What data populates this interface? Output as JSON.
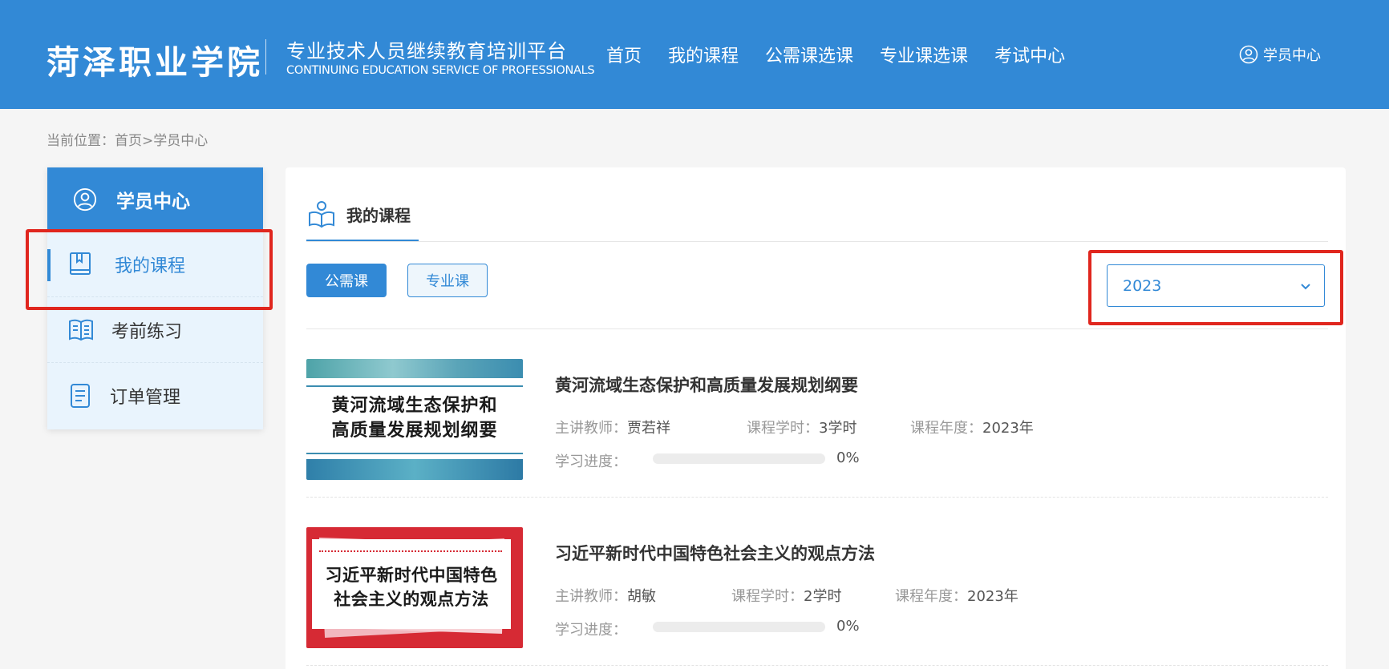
{
  "header": {
    "logo": "菏泽职业学院",
    "platform_cn": "专业技术人员继续教育培训平台",
    "platform_en": "CONTINUING EDUCATION SERVICE OF PROFESSIONALS",
    "nav": [
      "首页",
      "我的课程",
      "公需课选课",
      "专业课选课",
      "考试中心"
    ],
    "user_link": "学员中心",
    "bg_color": "#3289d6"
  },
  "breadcrumb": "当前位置：首页>学员中心",
  "sidebar": {
    "title": "学员中心",
    "items": [
      {
        "label": "我的课程",
        "icon": "book-icon",
        "active": true
      },
      {
        "label": "考前练习",
        "icon": "open-book-icon",
        "active": false
      },
      {
        "label": "订单管理",
        "icon": "document-icon",
        "active": false
      }
    ]
  },
  "main": {
    "tab_label": "我的课程",
    "tab_icon": "reading-person-icon",
    "filters": {
      "public": "公需课",
      "professional": "专业课"
    },
    "year_select": {
      "value": "2023"
    },
    "courses": [
      {
        "thumb_text_1": "黄河流域生态保护和",
        "thumb_text_2": "高质量发展规划纲要",
        "title": "黄河流域生态保护和高质量发展规划纲要",
        "teacher_label": "主讲教师：",
        "teacher": "贾若祥",
        "hours_label": "课程学时：",
        "hours": "3学时",
        "year_label": "课程年度：",
        "year": "2023年",
        "progress_label": "学习进度：",
        "progress_text": "0%",
        "progress": 0
      },
      {
        "thumb_text_1": "习近平新时代中国特色",
        "thumb_text_2": "社会主义的观点方法",
        "title": "习近平新时代中国特色社会主义的观点方法",
        "teacher_label": "主讲教师：",
        "teacher": "胡敏",
        "hours_label": "课程学时：",
        "hours": "2学时",
        "year_label": "课程年度：",
        "year": "2023年",
        "progress_label": "学习进度：",
        "progress_text": "0%",
        "progress": 0
      }
    ]
  },
  "highlight_color": "#e0261e"
}
